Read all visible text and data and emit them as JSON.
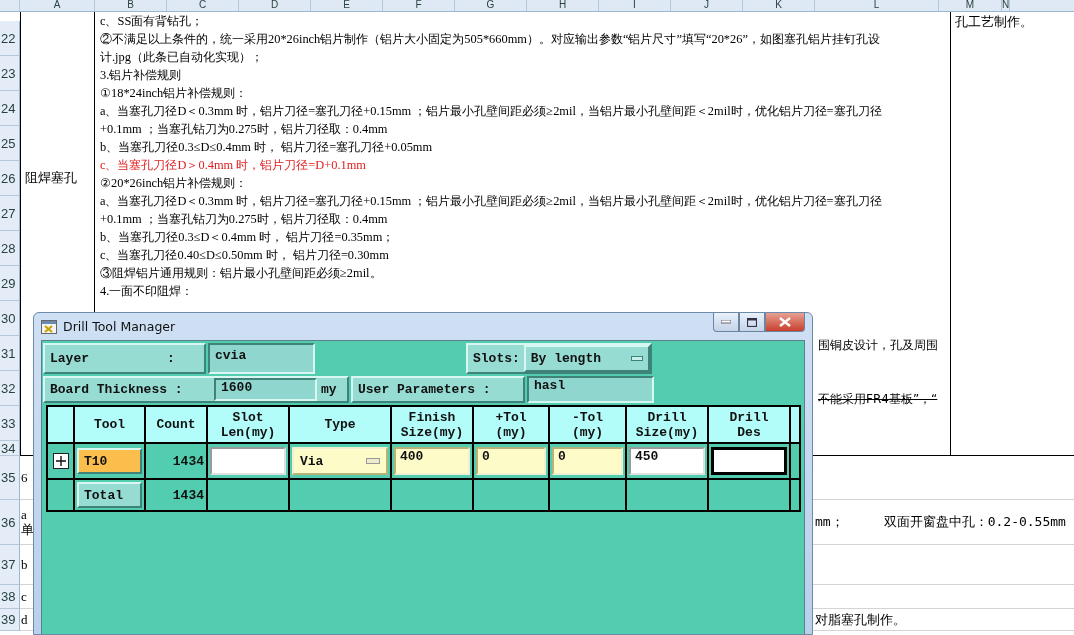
{
  "spreadsheet": {
    "column_headers": [
      "A",
      "B",
      "C",
      "D",
      "E",
      "F",
      "G",
      "H",
      "I",
      "J",
      "K",
      "L",
      "M",
      "N"
    ],
    "row_numbers": [
      "22",
      "23",
      "24",
      "25",
      "26",
      "27",
      "28",
      "29",
      "30",
      "31",
      "32",
      "33",
      "34"
    ],
    "category": "阻焊塞孔",
    "lines": [
      {
        "kind": "full",
        "text": "c、SS面有背钻孔；",
        "emphasis": false,
        "strike": false
      },
      {
        "kind": "full",
        "text": "②不满足以上条件的，统一采用20*26inch铝片制作（铝片大小固定为505*660mm）。对应输出参数“铝片尺寸”填写“20*26”，如图塞孔铝片挂钉孔设",
        "emphasis": false,
        "strike": false
      },
      {
        "kind": "full",
        "text": "计.jpg（此条已自动化实现）；",
        "emphasis": false,
        "strike": false
      },
      {
        "kind": "full",
        "text": "3.铝片补偿规则",
        "emphasis": false,
        "strike": false
      },
      {
        "kind": "full",
        "text": "①18*24inch铝片补偿规则：",
        "emphasis": false,
        "strike": false
      },
      {
        "kind": "full",
        "text": "a、当塞孔刀径D＜0.3mm 时，铝片刀径=塞孔刀径+0.15mm ；铝片最小孔壁间距必须≥2mil，当铝片最小孔壁间距＜2mil时，优化铝片刀径=塞孔刀径",
        "emphasis": false,
        "strike": false
      },
      {
        "kind": "full",
        "text": "+0.1mm ；当塞孔钻刀为0.275时，铝片刀径取：0.4mm",
        "emphasis": false,
        "strike": false
      },
      {
        "kind": "full",
        "text": "b、当塞孔刀径0.3≤D≤0.4mm 时， 铝片刀径=塞孔刀径+0.05mm",
        "emphasis": false,
        "strike": false
      },
      {
        "kind": "full",
        "text": "c、当塞孔刀径D＞0.4mm 时，铝片刀径=D+0.1mm",
        "emphasis": true,
        "strike": false
      },
      {
        "kind": "full",
        "text": "②20*26inch铝片补偿规则：",
        "emphasis": false,
        "strike": false
      },
      {
        "kind": "full",
        "text": "a、当塞孔刀径D＜0.3mm 时，铝片刀径=塞孔刀径+0.15mm ；铝片最小孔壁间距必须≥2mil，当铝片最小孔壁间距＜2mil时，优化铝片刀径=塞孔刀径",
        "emphasis": false,
        "strike": false
      },
      {
        "kind": "full",
        "text": "+0.1mm ；当塞孔钻刀为0.275时，铝片刀径取：0.4mm",
        "emphasis": false,
        "strike": false
      },
      {
        "kind": "full",
        "text": "b、当塞孔刀径0.3≤D＜0.4mm 时， 铝片刀径=0.35mm；",
        "emphasis": false,
        "strike": false
      },
      {
        "kind": "full",
        "text": "c、当塞孔刀径0.40≤D≤0.50mm 时， 铝片刀径=0.30mm",
        "emphasis": false,
        "strike": false
      },
      {
        "kind": "full",
        "text": "③阻焊铝片通用规则：铝片最小孔壁间距必须≥2mil。",
        "emphasis": false,
        "strike": false
      },
      {
        "kind": "full",
        "text": "4.一面不印阻焊：",
        "emphasis": false,
        "strike": false
      },
      {
        "kind": "tail",
        "text": "围铜皮设计，孔及周围",
        "emphasis": false,
        "strike": false
      },
      {
        "kind": "tail",
        "text": "不能采用FR4基板”，“",
        "emphasis": false,
        "strike": true
      }
    ],
    "side_note": "孔工艺制作。",
    "lower_rows": [
      {
        "number": "35",
        "col_a": [
          "6"
        ]
      },
      {
        "number": "36",
        "col_a": [
          "a",
          "单"
        ],
        "tails": [
          "mm；",
          "双面开窗盘中孔：0.2-0.55mm"
        ]
      },
      {
        "number": "37",
        "col_a": [
          "b"
        ]
      },
      {
        "number": "38",
        "col_a": [
          "c"
        ]
      },
      {
        "number": "39",
        "col_a": [
          "d"
        ],
        "tails": [
          "对脂塞孔制作。"
        ]
      }
    ]
  },
  "dialog": {
    "title": "Drill Tool Manager",
    "layer": {
      "label": "Layer          :",
      "value": "cvia"
    },
    "slots": {
      "label": "Slots:",
      "value": "By length"
    },
    "board_thickness": {
      "label": "Board Thickness :",
      "value": "1600",
      "unit": "my"
    },
    "user_parameters": {
      "label": "User Parameters :",
      "value": "hasl"
    },
    "table": {
      "columns": [
        "Tool",
        "Count",
        "Slot\nLen(my)",
        "Type",
        "Finish\nSize(my)",
        "+Tol\n(my)",
        "-Tol\n(my)",
        "Drill\nSize(my)",
        "Drill\nDes"
      ],
      "rows": [
        {
          "kind": "tool",
          "expanded": false,
          "tool": "T10",
          "selected": true,
          "count": "1434",
          "fields": [
            {
              "kind": "input",
              "highlighted": false,
              "focused": false
            },
            {
              "kind": "menu",
              "value": "Via",
              "highlighted": true,
              "focused": false
            },
            {
              "kind": "input",
              "value": "400",
              "highlighted": true,
              "focused": false
            },
            {
              "kind": "input",
              "value": "0",
              "highlighted": true,
              "focused": false
            },
            {
              "kind": "input",
              "value": "0",
              "highlighted": true,
              "focused": false
            },
            {
              "kind": "input",
              "value": "450",
              "highlighted": false,
              "focused": false
            },
            {
              "kind": "input",
              "highlighted": false,
              "focused": true
            }
          ]
        },
        {
          "kind": "summary",
          "tool": "Total",
          "selected": false,
          "count": "1434"
        }
      ]
    }
  }
}
